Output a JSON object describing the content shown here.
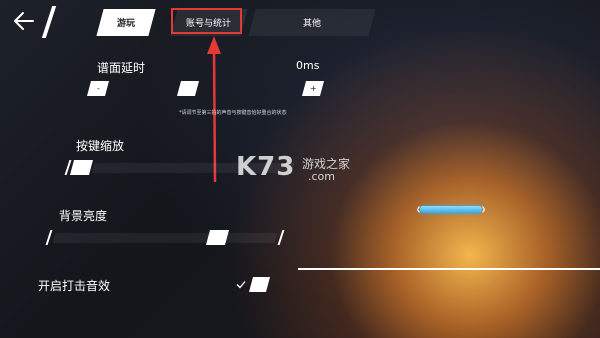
{
  "tabs": {
    "play": "游玩",
    "account": "账号与统计",
    "other": "其他"
  },
  "settings": {
    "latency": {
      "label": "谱面延时",
      "value": "0ms",
      "minus": "-",
      "plus": "+",
      "note": "*请调节至第三拍的声音与按键音恰好重合的状态"
    },
    "key_scale": {
      "label": "按键缩放"
    },
    "brightness": {
      "label": "背景亮度"
    },
    "hit_sound": {
      "label": "开启打击音效",
      "checked": true
    }
  },
  "watermark": {
    "brand": "K73",
    "site": "游戏之家",
    "domain": ".com"
  },
  "colors": {
    "annotation_red": "#e53935",
    "accent_blue": "#36a9e6",
    "glow_orange": "#ffb84d"
  }
}
